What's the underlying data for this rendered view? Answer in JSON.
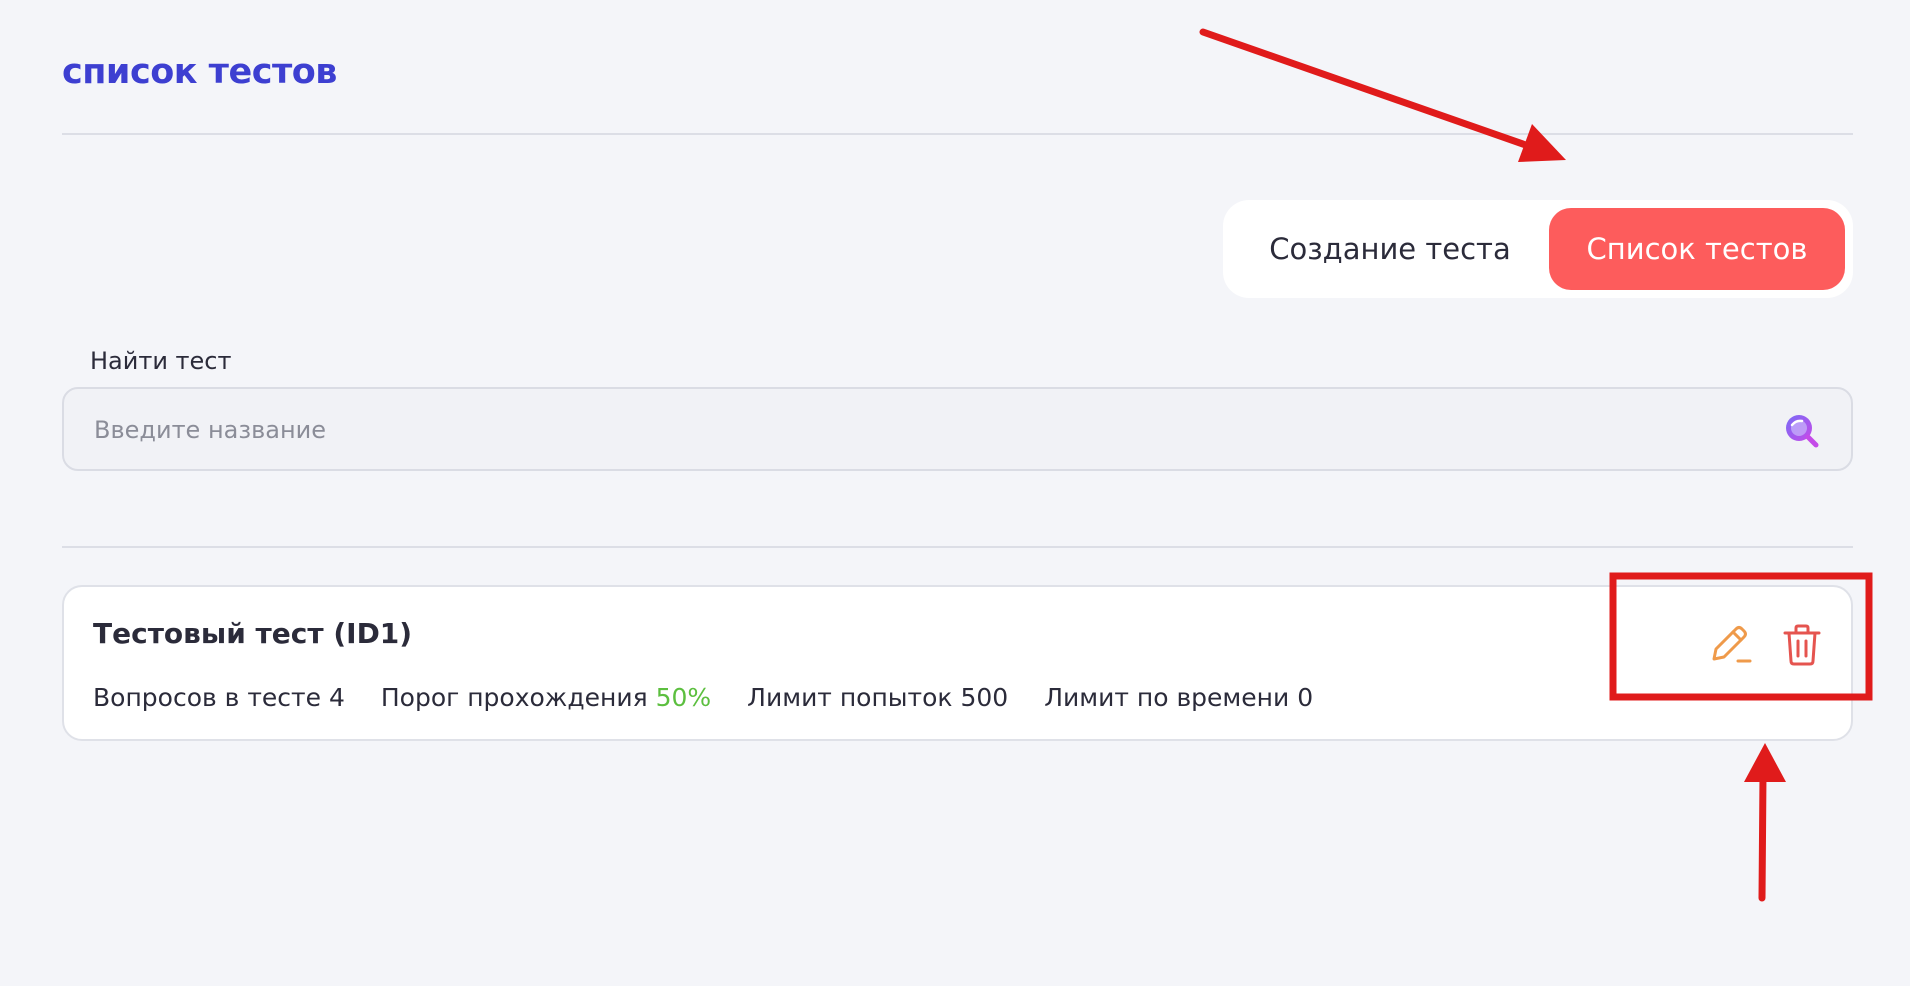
{
  "page": {
    "title": "список тестов"
  },
  "tabs": [
    {
      "label": "Создание теста",
      "active": false
    },
    {
      "label": "Список тестов",
      "active": true
    }
  ],
  "search": {
    "label": "Найти тест",
    "placeholder": "Введите название",
    "value": ""
  },
  "tests": [
    {
      "name": "Тестовый тест (ID1)",
      "questions_label": "Вопросов в тесте",
      "questions": "4",
      "pass_label": "Порог прохождения",
      "pass_value": "50%",
      "attempts_label": "Лимит попыток",
      "attempts": "500",
      "time_label": "Лимит по времени",
      "time": "0"
    }
  ],
  "icons": {
    "search": "search-icon",
    "edit": "pencil-icon",
    "delete": "trash-icon"
  },
  "colors": {
    "title": "#3d3fd1",
    "active_tab": "#fd5c5c",
    "pass_value": "#5cbf3f",
    "edit_icon": "#ef9a4a",
    "delete_icon": "#e5544f",
    "search_icon": "#a94ef0",
    "annotation": "#e01b1b"
  }
}
